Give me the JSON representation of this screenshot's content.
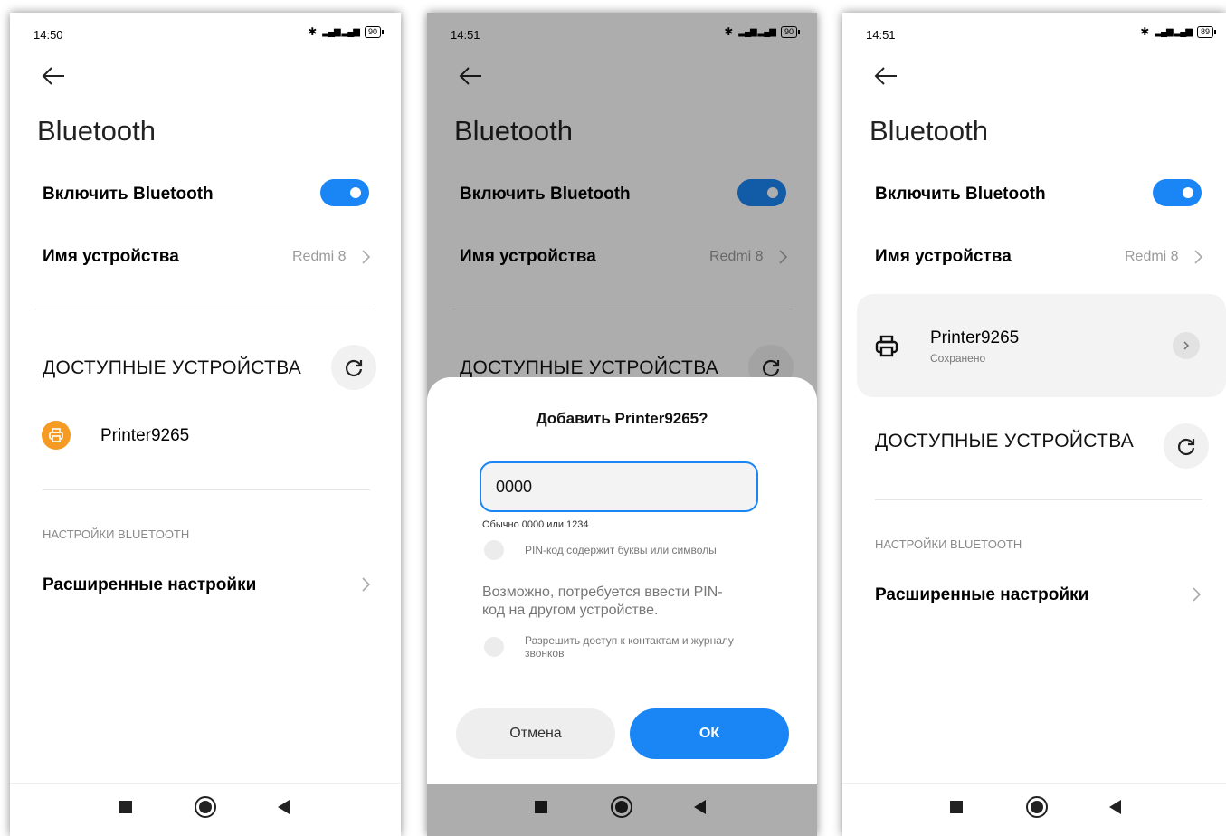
{
  "screens": [
    {
      "status": {
        "time": "14:50",
        "battery": "90"
      },
      "title": "Bluetooth",
      "toggle_label": "Включить Bluetooth",
      "device_name_label": "Имя устройства",
      "device_name_value": "Redmi 8",
      "available_header": "ДОСТУПНЫЕ УСТРОЙСТВА",
      "available_device": "Printer9265",
      "settings_header": "НАСТРОЙКИ BLUETOOTH",
      "advanced_label": "Расширенные настройки"
    },
    {
      "status": {
        "time": "14:51",
        "battery": "90"
      },
      "title": "Bluetooth",
      "toggle_label": "Включить Bluetooth",
      "device_name_label": "Имя устройства",
      "device_name_value": "Redmi 8",
      "available_header": "ДОСТУПНЫЕ УСТРОЙСТВА",
      "dialog": {
        "title": "Добавить Printer9265?",
        "pin_value": "0000",
        "hint": "Обычно 0000 или 1234",
        "checkbox_letters": "PIN-код содержит буквы или символы",
        "info": "Возможно, потребуется ввести PIN-код на другом устройстве.",
        "checkbox_contacts": "Разрешить доступ к контактам и журналу звонков",
        "cancel": "Отмена",
        "ok": "ОК"
      }
    },
    {
      "status": {
        "time": "14:51",
        "battery": "89"
      },
      "title": "Bluetooth",
      "toggle_label": "Включить Bluetooth",
      "device_name_label": "Имя устройства",
      "device_name_value": "Redmi 8",
      "saved_device": {
        "name": "Printer9265",
        "status": "Сохранено"
      },
      "available_header": "ДОСТУПНЫЕ УСТРОЙСТВА",
      "settings_header": "НАСТРОЙКИ BLUETOOTH",
      "advanced_label": "Расширенные настройки"
    }
  ],
  "colors": {
    "accent": "#1a86f6",
    "printer_badge": "#f59a23"
  },
  "icons": [
    "back-arrow-icon",
    "bluetooth-icon",
    "signal-icon",
    "battery-icon",
    "refresh-icon",
    "printer-icon",
    "chevron-right-icon",
    "nav-recents-icon",
    "nav-home-icon",
    "nav-back-icon"
  ]
}
